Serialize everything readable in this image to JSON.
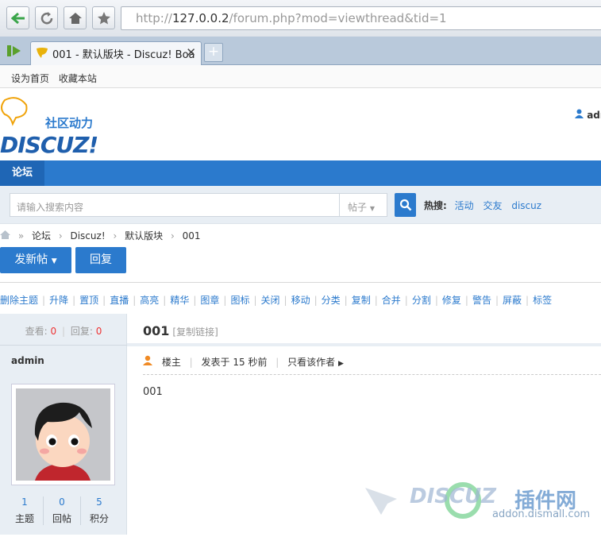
{
  "browser": {
    "url_prefix": "http://",
    "url_host": "127.0.0.2",
    "url_path": "/forum.php?mod=viewthread&tid=1",
    "tab_title": "001 - 默认版块 - Discuz! Boa",
    "new_tab": "+",
    "close": "✕"
  },
  "bookmarks": [
    "设为首页",
    "收藏本站"
  ],
  "header": {
    "logo_cn": "社区动力",
    "logo_en": "DISCUZ!",
    "user": "adr"
  },
  "nav": {
    "current": "论坛"
  },
  "search": {
    "placeholder": "请输入搜索内容",
    "type": "帖子",
    "hot_label": "热搜:",
    "hot": [
      "活动",
      "交友",
      "discuz"
    ]
  },
  "breadcrumb": [
    "论坛",
    "Discuz!",
    "默认版块",
    "001"
  ],
  "buttons": {
    "new_post": "发新帖",
    "reply": "回复"
  },
  "mod_actions": [
    "删除主题",
    "升降",
    "置顶",
    "直播",
    "高亮",
    "精华",
    "图章",
    "图标",
    "关闭",
    "移动",
    "分类",
    "复制",
    "合并",
    "分割",
    "修复",
    "警告",
    "屏蔽",
    "标签"
  ],
  "sidebar": {
    "views_label": "查看:",
    "views": "0",
    "replies_label": "回复:",
    "replies": "0",
    "username": "admin",
    "stats": [
      {
        "n": "1",
        "l": "主题"
      },
      {
        "n": "0",
        "l": "回帖"
      },
      {
        "n": "5",
        "l": "积分"
      }
    ]
  },
  "post": {
    "title": "001",
    "copy_link": "[复制链接]",
    "floor": "楼主",
    "time": "发表于 15 秒前",
    "only_author": "只看该作者",
    "content": "001"
  },
  "watermark": {
    "brand": "DISCUZ",
    "cn": "插件网",
    "url": "addon.dismall.com"
  },
  "colors": {
    "accent": "#2b7acd",
    "red": "#e33"
  }
}
